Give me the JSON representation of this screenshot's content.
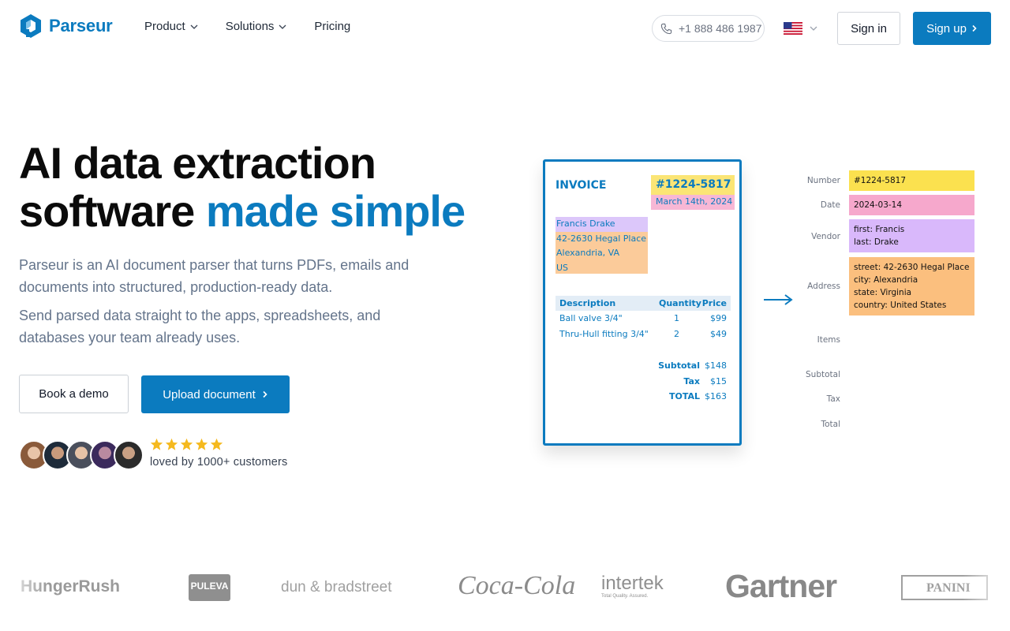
{
  "nav": {
    "logo_text": "Parseur",
    "menu": [
      {
        "label": "Product",
        "has_dropdown": true
      },
      {
        "label": "Solutions",
        "has_dropdown": true
      },
      {
        "label": "Pricing",
        "has_dropdown": false
      }
    ],
    "phone": "+1 888 486 1987",
    "phone_icon": "phone-icon",
    "locale_icon": "us-flag-icon",
    "sign_in": "Sign in",
    "sign_up": "Sign up"
  },
  "hero": {
    "title_line1": "AI data extraction",
    "title_line2_plain": "software",
    "title_line2_accent": "made simple",
    "paragraph1": "Parseur is an AI document parser that turns PDFs, emails and documents into structured, production-ready data.",
    "paragraph2": "Send parsed data straight to the apps, spreadsheets, and databases your team already uses.",
    "book_demo": "Book a demo",
    "upload": "Upload document",
    "rating_stars": 5,
    "social_proof": "loved by 1000+ customers"
  },
  "invoice": {
    "title": "INVOICE",
    "number": "#1224-5817",
    "date": "March 14th, 2024",
    "name": "Francis Drake",
    "address_lines": [
      "42-2630 Hegal Place",
      "Alexandria, VA",
      "US"
    ],
    "headers": {
      "description": "Description",
      "quantity": "Quantity",
      "price": "Price"
    },
    "items": [
      {
        "description": "Ball valve 3/4\"",
        "quantity": "1",
        "price": "$99"
      },
      {
        "description": "Thru-Hull fitting 3/4\"",
        "quantity": "2",
        "price": "$49"
      }
    ],
    "totals": [
      {
        "label": "Subtotal",
        "value": "$148"
      },
      {
        "label": "Tax",
        "value": "$15"
      },
      {
        "label": "TOTAL",
        "value": "$163"
      }
    ]
  },
  "extracted": {
    "labels": {
      "number": "Number",
      "date": "Date",
      "vendor": "Vendor",
      "address": "Address",
      "items": "Items",
      "subtotal": "Subtotal",
      "tax": "Tax",
      "total": "Total"
    },
    "values": {
      "number": "#1224-5817",
      "date": "2024-03-14",
      "vendor_first": "first: Francis",
      "vendor_last": "last: Drake",
      "street": "street: 42-2630 Hegal Place",
      "city": "city: Alexandria",
      "state": "state: Virginia",
      "country": "country: United States"
    },
    "colors": {
      "yellow": "#fbe14f",
      "pink": "#f6a8cc",
      "purple": "#d9b8fb",
      "orange": "#fbbf7e"
    }
  },
  "logos": [
    "HungerRush",
    "PULEVA",
    "dun & bradstreet",
    "Coca-Cola",
    "intertek",
    "Total Quality. Assured.",
    "Gartner",
    "PANINI"
  ],
  "colors": {
    "brand": "#0b7bbf",
    "star": "#f5b91e"
  }
}
